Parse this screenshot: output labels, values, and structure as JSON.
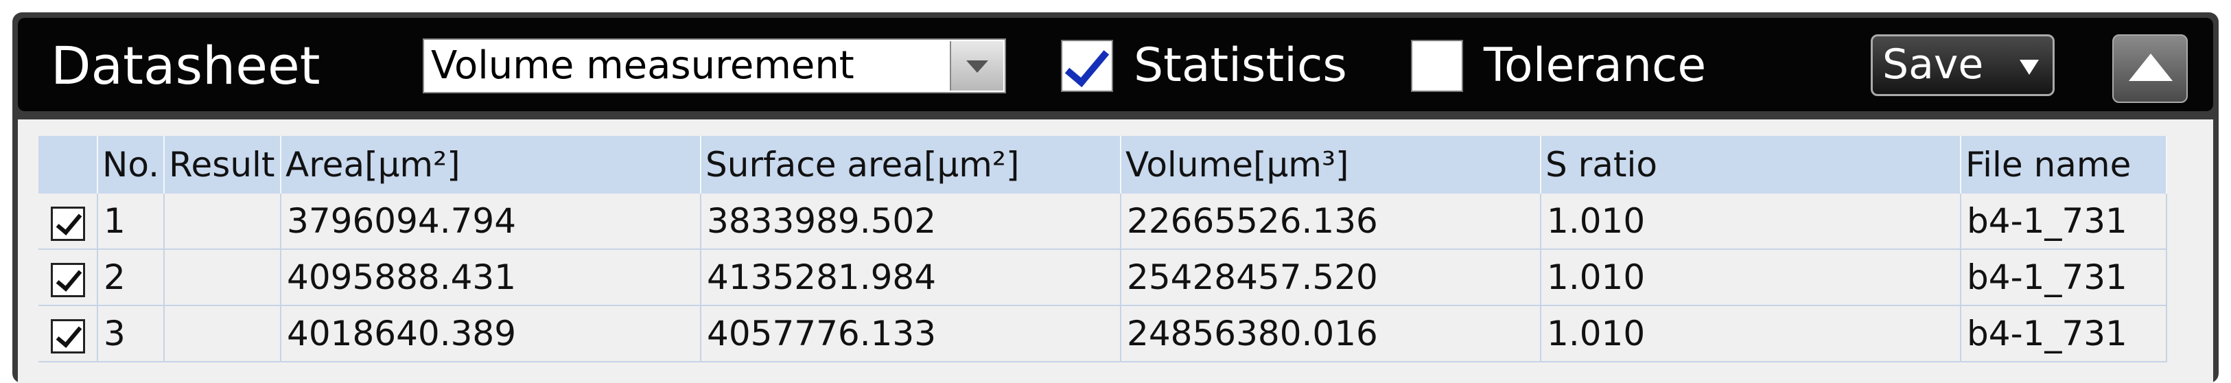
{
  "toolbar": {
    "title": "Datasheet",
    "mode_select": {
      "value": "Volume measurement"
    },
    "statistics": {
      "label": "Statistics",
      "checked": true
    },
    "tolerance": {
      "label": "Tolerance",
      "checked": false
    },
    "save_label": "Save"
  },
  "table": {
    "columns": [
      "",
      "No.",
      "Result",
      "Area[μm²]",
      "Surface area[μm²]",
      "Volume[μm³]",
      "S ratio",
      "File name"
    ],
    "rows": [
      {
        "checked": true,
        "no": "1",
        "result": "",
        "area": "3796094.794",
        "surface_area": "3833989.502",
        "volume": "22665526.136",
        "s_ratio": "1.010",
        "file_name": "b4-1_731"
      },
      {
        "checked": true,
        "no": "2",
        "result": "",
        "area": "4095888.431",
        "surface_area": "4135281.984",
        "volume": "25428457.520",
        "s_ratio": "1.010",
        "file_name": "b4-1_731"
      },
      {
        "checked": true,
        "no": "3",
        "result": "",
        "area": "4018640.389",
        "surface_area": "4057776.133",
        "volume": "24856380.016",
        "s_ratio": "1.010",
        "file_name": "b4-1_731"
      }
    ]
  }
}
